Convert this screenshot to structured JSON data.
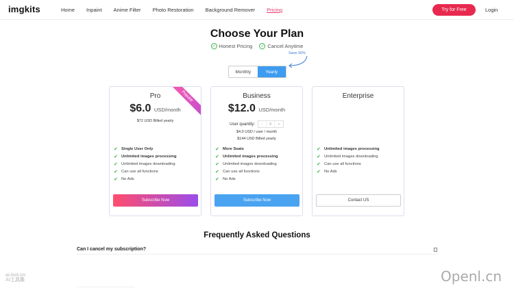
{
  "nav": {
    "logo": "imgkits",
    "links": [
      "Home",
      "Inpaint",
      "Anime Filter",
      "Photo Restoration",
      "Background Remover",
      "Pricing"
    ],
    "active": "Pricing",
    "try_label": "Try for Free",
    "login_label": "Login",
    "accent": "#e8294f"
  },
  "header": {
    "title": "Choose Your Plan",
    "features": [
      "Honest Pricing",
      "Cancel Anytime"
    ],
    "save_note": "Save 50%",
    "toggle": {
      "options": [
        "Monthly",
        "Yearly"
      ],
      "selected": "Yearly"
    }
  },
  "plans": [
    {
      "name": "Pro",
      "price": "$6.0",
      "unit": "USD/month",
      "billed": "$72 USD Billed yearly",
      "badge": "Popular",
      "features": [
        "Single User Only",
        "Unlimited images processing",
        "Unlimited images downloading",
        "Can use all functions",
        "No Ads"
      ],
      "cta": "Subscribe Now"
    },
    {
      "name": "Business",
      "price": "$12.0",
      "unit": "USD/month",
      "quantity_label": "User quantity:",
      "quantity": {
        "minus": "-",
        "value": "4",
        "plus": "+"
      },
      "per_user": "$4.0 USD / user / month",
      "billed": "$144 USD Billed yearly",
      "features": [
        "More Seats",
        "Unlimited images processing",
        "Unlimited images downloading",
        "Can use all functions",
        "No Ads"
      ],
      "cta": "Subscribe Now"
    },
    {
      "name": "Enterprise",
      "features": [
        "Unlimited images processing",
        "Unlimited images downloading",
        "Can use all functions",
        "No Ads"
      ],
      "cta": "Contact US"
    }
  ],
  "faq": {
    "title": "Frequently Asked Questions",
    "questions": [
      "Can I cancel my subscription?"
    ]
  },
  "watermarks": {
    "left": "ai-bot.cn\nAI工具集",
    "right": "Openl.cn"
  }
}
